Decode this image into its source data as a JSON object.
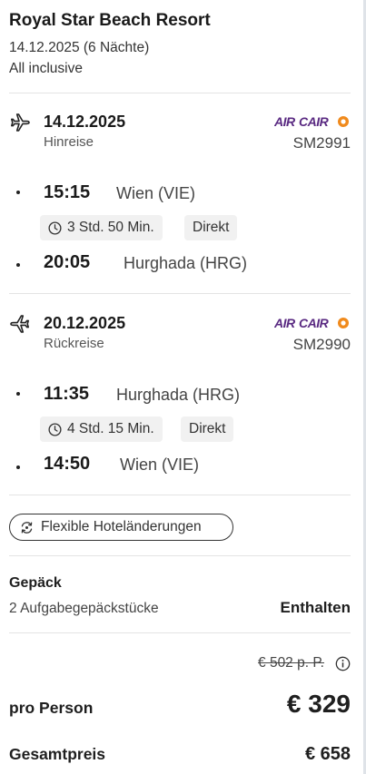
{
  "hotel": {
    "name": "Royal Star Beach Resort",
    "dates": "14.12.2025 (6 Nächte)",
    "board": "All inclusive"
  },
  "outbound": {
    "date": "14.12.2025",
    "direction": "Hinreise",
    "airline_logo_text": "AIRCAIRO",
    "flight_number": "SM2991",
    "departure_time": "15:15",
    "departure_place": "Wien (VIE)",
    "duration": "3 Std. 50 Min.",
    "stop_type": "Direkt",
    "arrival_time": "20:05",
    "arrival_place": "Hurghada (HRG)"
  },
  "return": {
    "date": "20.12.2025",
    "direction": "Rückreise",
    "airline_logo_text": "AIRCAIRO",
    "flight_number": "SM2990",
    "departure_time": "11:35",
    "departure_place": "Hurghada (HRG)",
    "duration": "4 Std. 15 Min.",
    "stop_type": "Direkt",
    "arrival_time": "14:50",
    "arrival_place": "Wien (VIE)"
  },
  "flex_button": {
    "label": "Flexible Hoteländerungen",
    "icon": "flex-change-icon"
  },
  "baggage": {
    "title": "Gepäck",
    "description": "2 Aufgabegepäckstücke",
    "status": "Enthalten"
  },
  "pricing": {
    "old_price": "€ 502 p. P.",
    "per_person_label": "pro Person",
    "per_person_price": "€ 329",
    "total_label": "Gesamtpreis",
    "total_price": "€ 658"
  },
  "colors": {
    "logo_purple": "#5a2a82",
    "logo_orange": "#f08a1c"
  }
}
